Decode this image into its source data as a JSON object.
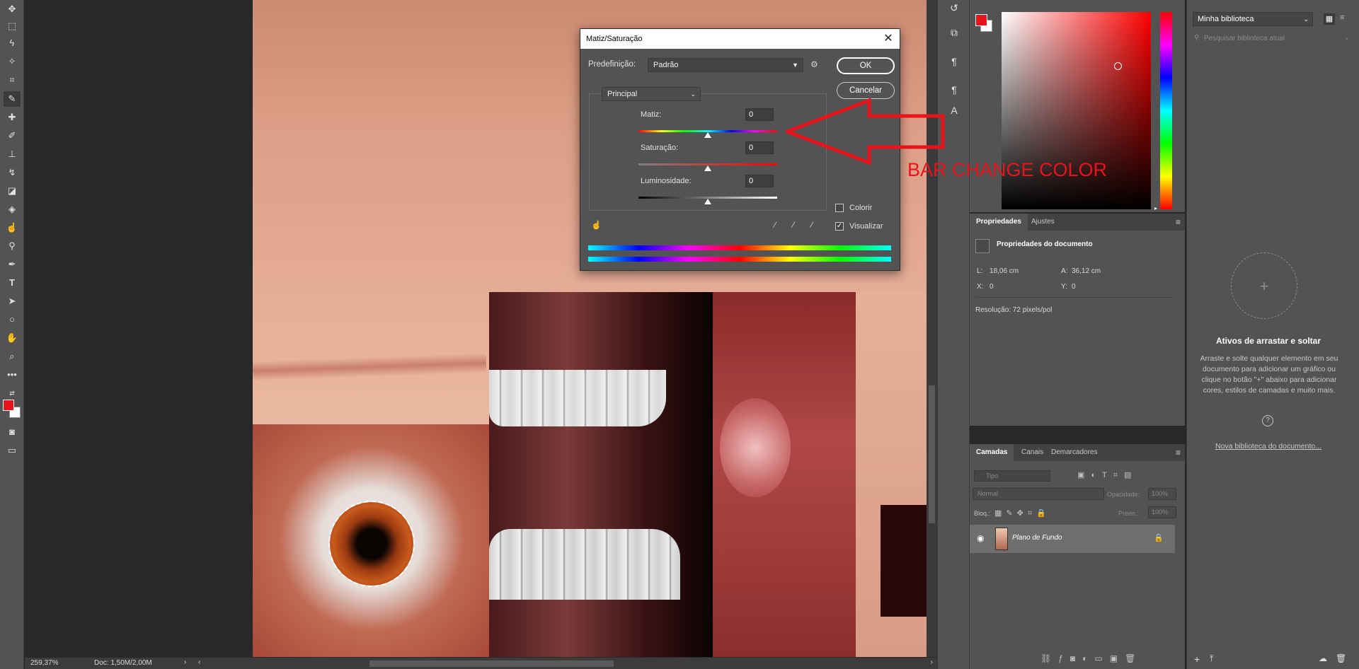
{
  "status": {
    "zoom": "259,37%",
    "doc": "Doc: 1,50M/2,00M"
  },
  "dialog": {
    "title": "Matiz/Saturação",
    "preset_label": "Predefinição:",
    "preset_value": "Padrão",
    "channel_value": "Principal",
    "ok_label": "OK",
    "cancel_label": "Cancelar",
    "hue_label": "Matiz:",
    "hue_value": "0",
    "saturation_label": "Saturação:",
    "saturation_value": "0",
    "lightness_label": "Luminosidade:",
    "lightness_value": "0",
    "colorize_label": "Colorir",
    "colorize_checked": false,
    "preview_label": "Visualizar",
    "preview_checked": true
  },
  "annotation": {
    "text": "BAR CHANGE COLOR",
    "color": "#e8141c"
  },
  "properties": {
    "tabs": [
      "Propriedades",
      "Ajustes"
    ],
    "heading": "Propriedades do documento",
    "l_label": "L:",
    "l_value": "18,06 cm",
    "a_label": "A:",
    "a_value": "36,12 cm",
    "x_label": "X:",
    "x_value": "0",
    "y_label": "Y:",
    "y_value": "0",
    "resolution": "Resolução: 72 pixels/pol"
  },
  "layers": {
    "tabs": [
      "Camadas",
      "Canais",
      "Demarcadores"
    ],
    "filter_placeholder": "Tipo",
    "blend_mode": "Normal",
    "opacity_label": "Opacidade:",
    "opacity_value": "100%",
    "lock_label": "Bloq.:",
    "fill_label": "Preen.:",
    "fill_value": "100%",
    "layer_name": "Plano de Fundo"
  },
  "library": {
    "select_value": "Minha biblioteca",
    "search_placeholder": "Pesquisar biblioteca atual",
    "title": "Ativos de arrastar e soltar",
    "description": "Arraste e solte qualquer elemento em seu documento para adicionar um gráfico ou clique no botão \"+\" abaixo para adicionar cores, estilos de camadas e muito mais.",
    "new_link": "Nova biblioteca do documento..."
  },
  "colors": {
    "foreground": "#e8141c",
    "background": "#ffffff"
  }
}
